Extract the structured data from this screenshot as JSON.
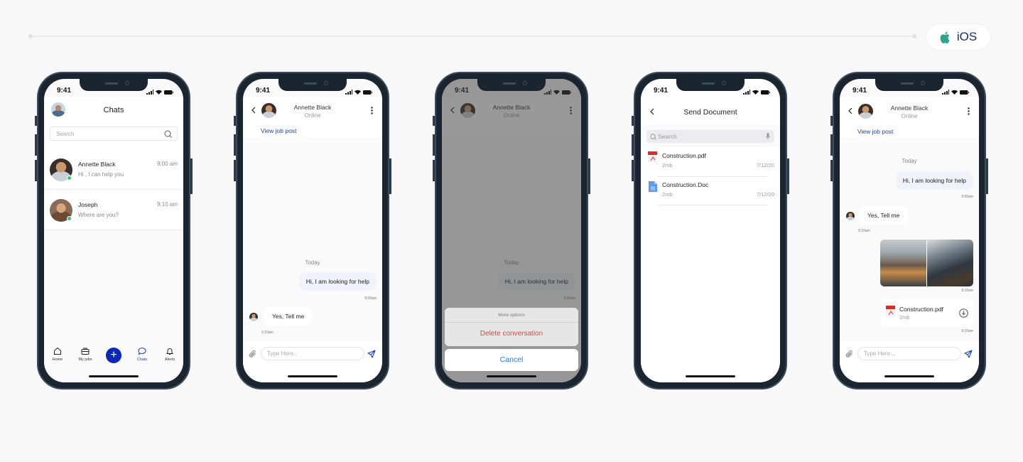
{
  "platform_badge": {
    "icon": "apple-icon",
    "label": "iOS",
    "icon_color": "#2fa38b"
  },
  "status": {
    "time": "9:41"
  },
  "screen1": {
    "title": "Chats",
    "search_placeholder": "Search",
    "chats": [
      {
        "name": "Annette Black",
        "message": "Hi , I can help you",
        "time": "9:00 am",
        "online": true
      },
      {
        "name": "Joseph",
        "message": "Where are you?",
        "time": "9:10 am",
        "online": true
      }
    ],
    "tabs": [
      {
        "label": "Home",
        "icon": "home-icon",
        "active": false
      },
      {
        "label": "My jobs",
        "icon": "briefcase-icon",
        "active": false
      },
      {
        "label": "Chats",
        "icon": "chat-bubble-icon",
        "active": true
      },
      {
        "label": "Alerts",
        "icon": "bell-icon",
        "active": false
      }
    ],
    "fab_label": "+"
  },
  "conversation": {
    "contact_name": "Annette Black",
    "contact_status": "Online",
    "job_link": "View job post",
    "day_label": "Today",
    "outgoing_message": "Hi, I am looking for help",
    "outgoing_time": "9:00am",
    "incoming_message": "Yes, Tell me",
    "incoming_time": "9:10am",
    "input_placeholder": "Type Here.."
  },
  "action_sheet": {
    "title": "More options",
    "destructive_action": "Delete conversation",
    "cancel": "Cancel"
  },
  "send_document": {
    "title": "Send Document",
    "search_placeholder": "Search",
    "files": [
      {
        "name": "Construction.pdf",
        "size": "2mb",
        "date": "7/12/20",
        "type": "pdf"
      },
      {
        "name": "Construction.Doc",
        "size": "2mb",
        "date": "7/12/20",
        "type": "doc"
      }
    ]
  },
  "conversation_full": {
    "images_time": "9:10am",
    "attachment_name": "Construction.pdf",
    "attachment_size": "2mb",
    "attachment_time": "9:10am",
    "input_placeholder": "Type Here..."
  }
}
